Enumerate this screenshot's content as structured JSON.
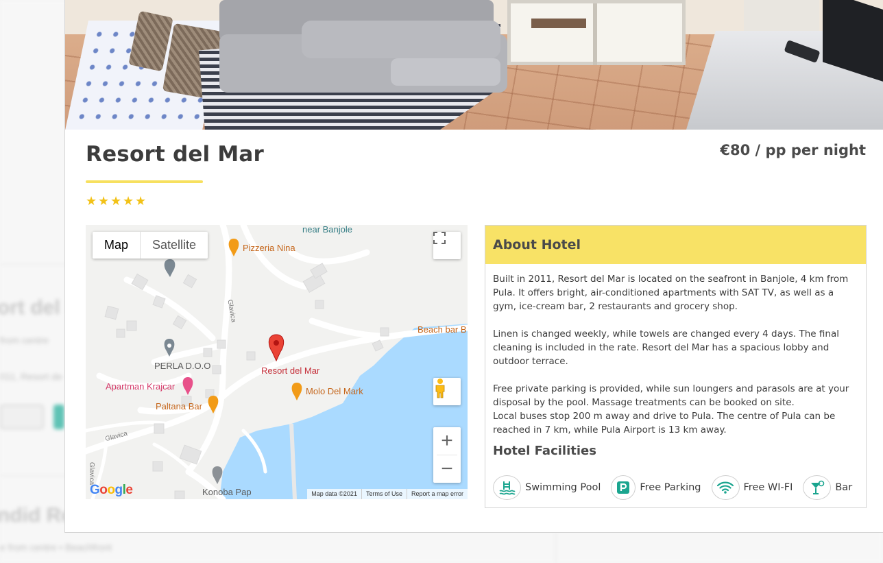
{
  "background_page": {
    "heading_1": "ort del M",
    "sub_1": "from centre",
    "snippet_1": "011, Resort de",
    "heading_2": "ndid Re",
    "sub_2": "e from centre  • Beachfront"
  },
  "hotel": {
    "name": "Resort del Mar",
    "price": "€80 / pp per night",
    "stars": 5
  },
  "map": {
    "type_buttons": [
      "Map",
      "Satellite"
    ],
    "labels": {
      "near": "near Banjole",
      "pizzeria": "Pizzeria Nina",
      "beach_bar": "Beach bar B",
      "perla": "PERLA D.O.O",
      "resort": "Resort del Mar",
      "apartman": "Apartman Krajcar",
      "molo": "Molo Del Mark",
      "paltana": "Paltana Bar",
      "konoba": "Konoba Pap",
      "street_glavica_1": "Glavica",
      "street_glavica_2": "Glavica",
      "street_glavica_3": "Glavica"
    },
    "google_logo": "Google",
    "attribution": {
      "data": "Map data ©2021",
      "terms": "Terms of Use",
      "report": "Report a map error"
    },
    "zoom_in": "+",
    "zoom_out": "−"
  },
  "about": {
    "title": "About Hotel",
    "paragraph_1": "Built in 2011, Resort del Mar is located on the seafront in Banjole, 4 km from Pula. It offers bright, air-conditioned apartments with SAT TV, as well as a gym, ice-cream bar, 2 restaurants and grocery shop.",
    "paragraph_2": "Linen is changed weekly, while towels are changed every 4 days. The final cleaning is included in the rate. Resort del Mar has a spacious lobby and outdoor terrace.",
    "paragraph_3": "Free private parking is provided, while sun loungers and parasols are at your disposal by the pool. Massage treatments can be booked on site.",
    "paragraph_4": "Local buses stop 200 m away and drive to Pula. The centre of Pula can be reached in 7 km, while Pula Airport is 13 km away.",
    "facilities_title": "Hotel Facilities",
    "facilities": [
      {
        "label": "Swimming Pool",
        "icon": "swimming-pool-icon"
      },
      {
        "label": "Free Parking",
        "icon": "parking-icon"
      },
      {
        "label": "Free WI-FI",
        "icon": "wifi-icon"
      },
      {
        "label": "Bar",
        "icon": "cocktail-icon"
      }
    ]
  },
  "colors": {
    "accent_yellow": "#f8e266",
    "star": "#f2c218",
    "facility_teal": "#1aa58f",
    "water": "#aadaff"
  }
}
